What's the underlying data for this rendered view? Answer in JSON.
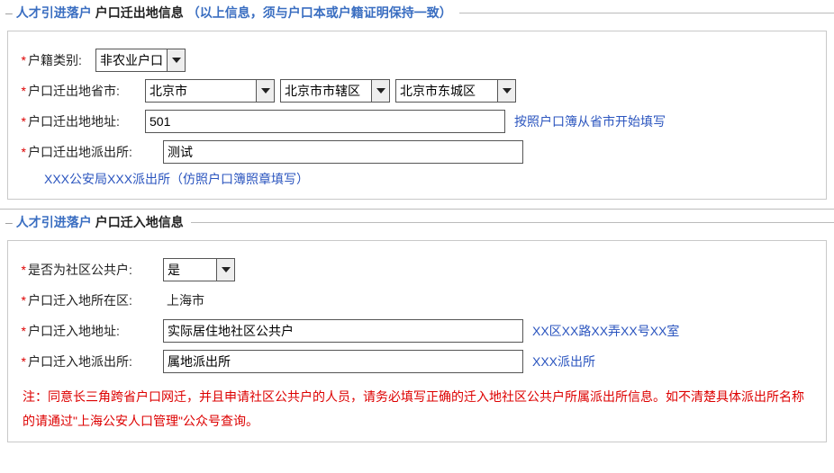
{
  "section1": {
    "legend_blue": "人才引进落户",
    "legend_black": "户口迁出地信息",
    "legend_note": "（以上信息，须与户口本或户籍证明保持一致）",
    "hukou_type_label": "户籍类别:",
    "hukou_type_value": "非农业户口",
    "prov_label": "户口迁出地省市:",
    "prov_value": "北京市",
    "city_value": "北京市市辖区",
    "district_value": "北京市东城区",
    "addr_label": "户口迁出地地址:",
    "addr_value": "501",
    "addr_hint": "按照户口簿从省市开始填写",
    "ps_label": "户口迁出地派出所:",
    "ps_value": "测试",
    "ps_hint": "XXX公安局XXX派出所（仿照户口簿照章填写）"
  },
  "section2": {
    "legend_blue": "人才引进落户",
    "legend_black": "户口迁入地信息",
    "community_label": "是否为社区公共户:",
    "community_value": "是",
    "area_label": "户口迁入地所在区:",
    "area_value": "上海市",
    "addr_label": "户口迁入地地址:",
    "addr_value": "实际居住地社区公共户",
    "addr_hint": "XX区XX路XX弄XX号XX室",
    "ps_label": "户口迁入地派出所:",
    "ps_value": "属地派出所",
    "ps_hint": "XXX派出所",
    "warn": "注：同意长三角跨省户口网迁，并且申请社区公共户的人员，请务必填写正确的迁入地社区公共户所属派出所信息。如不清楚具体派出所名称的请通过\"上海公安人口管理\"公众号查询。"
  }
}
